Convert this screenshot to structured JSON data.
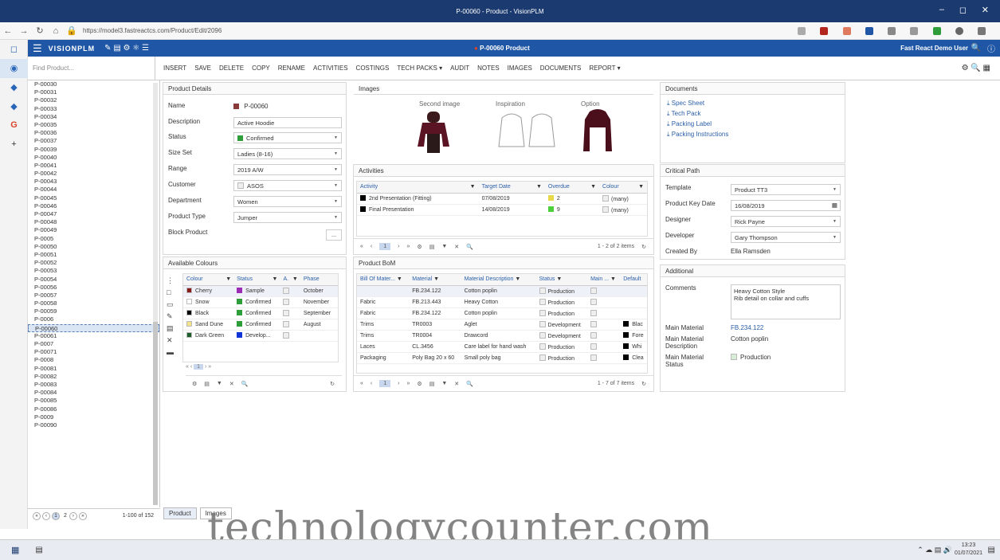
{
  "window": {
    "title": "P-00060 - Product - VisionPLM",
    "controls": [
      "–",
      "◻",
      "✕"
    ]
  },
  "browser": {
    "url": "https://model3.fastreactcs.com/Product/Edit/2096"
  },
  "app": {
    "logo": "VISIONPLM",
    "record_title": "P-00060 Product",
    "user": "Fast React Demo User"
  },
  "search": {
    "placeholder": "Find Product..."
  },
  "toolbar": {
    "buttons": [
      "INSERT",
      "SAVE",
      "DELETE",
      "COPY",
      "RENAME",
      "ACTIVITIES",
      "COSTINGS",
      "TECH PACKS ▾",
      "AUDIT",
      "NOTES",
      "IMAGES",
      "DOCUMENTS",
      "REPORT ▾"
    ]
  },
  "product_list": {
    "items": [
      "P-00030",
      "P-00031",
      "P-00032",
      "P-00033",
      "P-00034",
      "P-00035",
      "P-00036",
      "P-00037",
      "P-00039",
      "P-00040",
      "P-00041",
      "P-00042",
      "P-00043",
      "P-00044",
      "P-00045",
      "P-00046",
      "P-00047",
      "P-00048",
      "P-00049",
      "P-0005",
      "P-00050",
      "P-00051",
      "P-00052",
      "P-00053",
      "P-00054",
      "P-00056",
      "P-00057",
      "P-00058",
      "P-00059",
      "P-0006",
      "P-00060",
      "P-00061",
      "P-0007",
      "P-00071",
      "P-0008",
      "P-00081",
      "P-00082",
      "P-00083",
      "P-00084",
      "P-00085",
      "P-00086",
      "P-0009",
      "P-00090"
    ],
    "selected": "P-00060",
    "pager": {
      "page1": "1",
      "page2": "2",
      "range": "1-100 of 152"
    }
  },
  "product_details": {
    "title": "Product Details",
    "fields": [
      {
        "label": "Name",
        "value": "P-00060"
      },
      {
        "label": "Description",
        "value": "Active Hoodie"
      },
      {
        "label": "Status",
        "value": "Confirmed"
      },
      {
        "label": "Size Set",
        "value": "Ladies (8-16)"
      },
      {
        "label": "Range",
        "value": "2019 A/W"
      },
      {
        "label": "Customer",
        "value": "ASOS"
      },
      {
        "label": "Department",
        "value": "Women"
      },
      {
        "label": "Product Type",
        "value": "Jumper"
      },
      {
        "label": "Block Product",
        "value": "..."
      }
    ]
  },
  "images": {
    "title": "Images",
    "labels": [
      "Second image",
      "Inspiration",
      "Option"
    ]
  },
  "documents": {
    "title": "Documents",
    "items": [
      "Spec Sheet",
      "Tech Pack",
      "Packing Label",
      "Packing Instructions"
    ]
  },
  "activities": {
    "title": "Activities",
    "columns": [
      "Activity",
      "Target Date",
      "Overdue",
      "Colour"
    ],
    "rows": [
      {
        "activity": "2nd Presentation (Fitting)",
        "date": "07/08/2019",
        "overdue": "2",
        "colour": "(many)"
      },
      {
        "activity": "Final Presentation",
        "date": "14/08/2019",
        "overdue": "9",
        "colour": "(many)"
      }
    ],
    "page": "1",
    "count": "1 - 2 of 2 items"
  },
  "critical_path": {
    "title": "Critical Path",
    "fields": [
      {
        "label": "Template",
        "value": "Product TT3"
      },
      {
        "label": "Product Key Date",
        "value": "16/08/2019"
      },
      {
        "label": "Designer",
        "value": "Rick Payne"
      },
      {
        "label": "Developer",
        "value": "Gary Thompson"
      },
      {
        "label": "Created By",
        "value": "Ella Ramsden"
      }
    ]
  },
  "additional": {
    "title": "Additional",
    "comments_label": "Comments",
    "comments_line1": "Heavy Cotton Style",
    "comments_line2": "Rib detail on collar and cuffs",
    "main_material_label": "Main Material",
    "main_material": "FB.234.122",
    "main_material_desc_label": "Main Material Description",
    "main_material_desc": "Cotton poplin",
    "main_material_status_label": "Main Material Status",
    "main_material_status": "Production"
  },
  "available_colours": {
    "title": "Available Colours",
    "columns": [
      "Colour",
      "Status",
      "A.",
      "Phase"
    ],
    "rows": [
      {
        "colour": "Cherry",
        "swatch": "#8b1a1a",
        "status": "Sample",
        "status_color": "#9b2bb5",
        "phase": "October"
      },
      {
        "colour": "Snow",
        "swatch": "#ffffff",
        "status": "Confirmed",
        "status_color": "#2e9e3a",
        "phase": "November"
      },
      {
        "colour": "Black",
        "swatch": "#000000",
        "status": "Confirmed",
        "status_color": "#2e9e3a",
        "phase": "September"
      },
      {
        "colour": "Sand Dune",
        "swatch": "#f2e38a",
        "status": "Confirmed",
        "status_color": "#2e9e3a",
        "phase": "August"
      },
      {
        "colour": "Dark Green",
        "swatch": "#1d5e2a",
        "status": "Develop...",
        "status_color": "#1034d8",
        "phase": ""
      }
    ],
    "page": "1"
  },
  "bom": {
    "title": "Product BoM",
    "columns": [
      "Bill Of Mater...",
      "Material",
      "Material Description",
      "Status",
      "Main ...",
      "Default"
    ],
    "rows": [
      {
        "bill": "",
        "material": "FB.234.122",
        "desc": "Cotton poplin",
        "status": "Production",
        "default": ""
      },
      {
        "bill": "Fabric",
        "material": "FB.213.443",
        "desc": "Heavy Cotton",
        "status": "Production",
        "default": ""
      },
      {
        "bill": "Fabric",
        "material": "FB.234.122",
        "desc": "Cotton poplin",
        "status": "Production",
        "default": ""
      },
      {
        "bill": "Trims",
        "material": "TR0003",
        "desc": "Aglet",
        "status": "Development",
        "default": "Blac"
      },
      {
        "bill": "Trims",
        "material": "TR0004",
        "desc": "Drawcord",
        "status": "Development",
        "default": "Fore"
      },
      {
        "bill": "Laces",
        "material": "CL.3456",
        "desc": "Care label for hand wash",
        "status": "Production",
        "default": "Whi"
      },
      {
        "bill": "Packaging",
        "material": "Poly Bag 20 x 60",
        "desc": "Small poly bag",
        "status": "Production",
        "default": "Clea"
      }
    ],
    "page": "1",
    "count": "1 - 7 of 7 items"
  },
  "bottom_tabs": [
    "Product",
    "Images"
  ],
  "watermark": "technologycounter.com",
  "taskbar": {
    "time": "13:23",
    "date": "01/07/2021"
  },
  "colors": {
    "accent": "#1f56a5",
    "titlebar": "#1b3a6f",
    "link": "#2a5fa8",
    "record_dot": "#d9442b"
  }
}
